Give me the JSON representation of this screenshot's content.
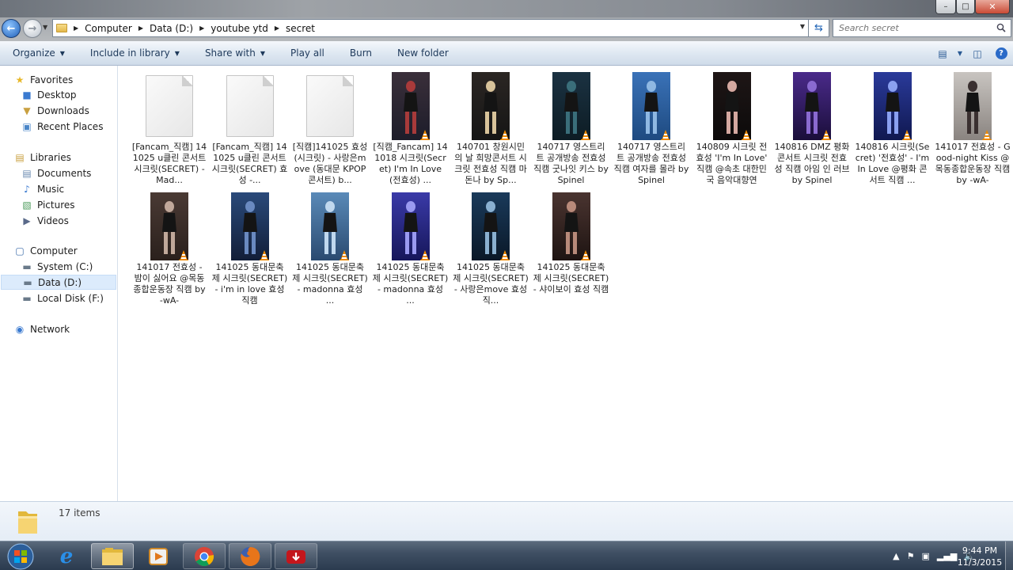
{
  "window": {
    "controls": {
      "minimize": "–",
      "maximize": "□",
      "close": "✕"
    }
  },
  "address": {
    "breadcrumbs": [
      "Computer",
      "Data (D:)",
      "youtube ytd",
      "secret"
    ],
    "search_placeholder": "Search secret"
  },
  "toolbar": {
    "buttons": [
      {
        "label": "Organize",
        "dropdown": true
      },
      {
        "label": "Include in library",
        "dropdown": true
      },
      {
        "label": "Share with",
        "dropdown": true
      },
      {
        "label": "Play all",
        "dropdown": false
      },
      {
        "label": "Burn",
        "dropdown": false
      },
      {
        "label": "New folder",
        "dropdown": false
      }
    ]
  },
  "nav": {
    "favorites": {
      "label": "Favorites",
      "items": [
        "Desktop",
        "Downloads",
        "Recent Places"
      ]
    },
    "libraries": {
      "label": "Libraries",
      "items": [
        "Documents",
        "Music",
        "Pictures",
        "Videos"
      ]
    },
    "computer": {
      "label": "Computer",
      "items": [
        "System (C:)",
        "Data (D:)",
        "Local Disk (F:)"
      ],
      "selected": "Data (D:)"
    },
    "network": {
      "label": "Network"
    }
  },
  "files": [
    {
      "name": "[Fancam_직캠] 141025 u클린 콘서트 시크릿(SECRET) - Mad...",
      "thumb": "blank"
    },
    {
      "name": "[Fancam_직캠] 141025 u클린 콘서트 시크릿(SECRET) 효성 -...",
      "thumb": "blank"
    },
    {
      "name": "[직캠]141025 효성(시크릿) - 사랑은move (동대문 KPOP콘서트) b...",
      "thumb": "blank"
    },
    {
      "name": "[직캠_Fancam] 141018 시크릿(Secret) I'm In Love (전효성) ...",
      "thumb": "video",
      "colors": [
        "#3a2f3a",
        "#a83a3a",
        "#1d1d2a"
      ]
    },
    {
      "name": "140701 창원시민의 날 희망콘서트 시크릿 전효성 직캠 마돈나 by Sp...",
      "thumb": "video",
      "colors": [
        "#2b2623",
        "#d8c39a",
        "#151515"
      ]
    },
    {
      "name": "140717 영스트리트 공개방송 전효성 직캠 굿나잇 키스 by Spinel",
      "thumb": "video",
      "colors": [
        "#1b3242",
        "#3a6e7a",
        "#0d1c24"
      ]
    },
    {
      "name": "140717 영스트리트 공개방송 전효성 직캠 여자를 몰라 by Spinel",
      "thumb": "video",
      "colors": [
        "#3a72b8",
        "#8fb8e2",
        "#1e4a80"
      ]
    },
    {
      "name": "140809 시크릿 전효성 'I'm In Love' 직캠 @속초 대한민국 음악대향연",
      "thumb": "video",
      "colors": [
        "#1e1616",
        "#d4a8a0",
        "#0c0a0a"
      ]
    },
    {
      "name": "140816 DMZ 평화콘서트 시크릿 전효성 직캠 아임 인 러브 by Spinel",
      "thumb": "video",
      "colors": [
        "#4a2a8a",
        "#8a6ad0",
        "#1a0e3a"
      ]
    },
    {
      "name": "140816 시크릿(Secret) '전효성' - I'm In Love @평화 콘서트 직캠 ...",
      "thumb": "video",
      "colors": [
        "#2a3a9a",
        "#8aa0f0",
        "#101850"
      ]
    },
    {
      "name": "141017 전효성 - Good-night Kiss @목동종합운동장 직캠 by -wA-",
      "thumb": "video",
      "colors": [
        "#c8c4c0",
        "#3a3030",
        "#8a8480"
      ]
    },
    {
      "name": "141017 전효성 - 밤이 싫어요 @목동종합운동장 직캠 by -wA-",
      "thumb": "video",
      "colors": [
        "#4a3a34",
        "#c0a89a",
        "#2a201c"
      ]
    },
    {
      "name": "141025 동대문축제 시크릿(SECRET) - i'm in love 효성 직캠",
      "thumb": "video",
      "colors": [
        "#2a4a7a",
        "#6a8ac0",
        "#121e38"
      ]
    },
    {
      "name": "141025 동대문축제 시크릿(SECRET) - madonna 효성 ...",
      "thumb": "video",
      "colors": [
        "#5a8ab8",
        "#c0d8ee",
        "#2a4a70"
      ]
    },
    {
      "name": "141025 동대문축제 시크릿(SECRET) - madonna 효성 ...",
      "thumb": "video",
      "colors": [
        "#3a3aa8",
        "#9a9af0",
        "#16165a"
      ]
    },
    {
      "name": "141025 동대문축제 시크릿(SECRET) - 사랑은move 효성 직...",
      "thumb": "video",
      "colors": [
        "#1a3a5a",
        "#8ab0d0",
        "#0a1828"
      ]
    },
    {
      "name": "141025 동대문축제 시크릿(SECRET) - 샤이보이 효성 직캠",
      "thumb": "video",
      "colors": [
        "#4a3430",
        "#b88a7a",
        "#1e1412"
      ]
    }
  ],
  "details": {
    "count": "17 items"
  },
  "taskbar": {
    "clock_time": "9:44 PM",
    "clock_date": "11/3/2015"
  },
  "colors": {
    "accent": "#1e395b",
    "selection": "#dcebfc",
    "vlc": "#f08a00"
  }
}
